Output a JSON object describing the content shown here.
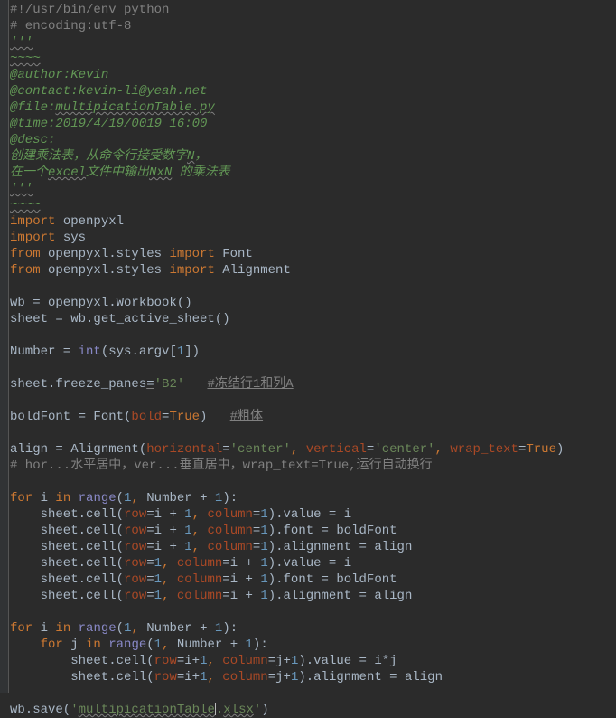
{
  "shebang": "#!/usr/bin/env python",
  "encoding": "# encoding:utf-8",
  "doc_open": "'''",
  "wave1": "~~~~",
  "author": "@author:Kevin",
  "contact": "@contact:kevin-li@yeah.net",
  "file_lbl": "@file:",
  "file_name": "multipicationTable.py",
  "time": "@time:2019/4/19/0019 16:00",
  "desc": "@desc:",
  "desc1_a": "创建乘法表，从命令行接受数字",
  "desc1_b": "N",
  "desc1_c": "，",
  "desc2_a": "在一个",
  "desc2_b": "excel",
  "desc2_c": "文件中输出",
  "desc2_d": "NxN",
  "desc2_e": " 的乘法表",
  "doc_close": "'''",
  "wave2": "~~~~",
  "imp1_kw": "import ",
  "imp1_mod": "openpyxl",
  "imp2_kw": "import ",
  "imp2_mod": "sys",
  "from1_kw": "from ",
  "from1_mod": "openpyxl.styles ",
  "from1_imp": "import ",
  "from1_what": "Font",
  "from2_kw": "from ",
  "from2_mod": "openpyxl.styles ",
  "from2_imp": "import ",
  "from2_what": "Alignment",
  "wb_line": "wb = openpyxl.Workbook()",
  "sheet_line": "sheet = wb.get_active_sheet()",
  "num_a": "Number = ",
  "num_b": "int",
  "num_c": "(sys.argv[",
  "num_d": "1",
  "num_e": "])",
  "freeze_a": "sheet.freeze_panes",
  "freeze_eq": "=",
  "freeze_b": "'B2'",
  "freeze_c": "#冻结行1和列A",
  "bold_a": "boldFont = Font(",
  "bold_p": "bold",
  "bold_eq": "=",
  "bold_v": "True",
  "bold_b": ")   ",
  "bold_c": "#粗体",
  "align_a": "align = Alignment(",
  "align_p1": "horizontal",
  "align_eq1": "=",
  "align_v1": "'center'",
  "align_comma1": ", ",
  "align_p2": "vertical",
  "align_eq2": "=",
  "align_v2": "'center'",
  "align_comma2": ", ",
  "align_p3": "wrap_text",
  "align_eq3": "=",
  "align_v3": "True",
  "align_b": ")",
  "align_comment": "# hor...水平居中，ver...垂直居中，wrap_text=True,运行自动换行",
  "for1_kw1": "for ",
  "for1_var": "i ",
  "for1_kw2": "in ",
  "for1_fn": "range",
  "for1_a": "(",
  "for1_n1": "1",
  "for1_c1": ", ",
  "for1_mid": "Number + ",
  "for1_n2": "1",
  "for1_b": "):",
  "l1_a": "    sheet.cell(",
  "l1_p1": "row",
  "l1_eq1": "=i + ",
  "l1_n1": "1",
  "l1_c1": ", ",
  "l1_p2": "column",
  "l1_eq2": "=",
  "l1_n2": "1",
  "l1_b": ").value = i",
  "l2_b": ").font = boldFont",
  "l3_b": ").alignment = align",
  "l4_a": "    sheet.cell(",
  "l4_p1": "row",
  "l4_eq1": "=",
  "l4_n1": "1",
  "l4_c1": ", ",
  "l4_p2": "column",
  "l4_eq2": "=i + ",
  "l4_n2": "1",
  "l4_b": ").value = i",
  "for2_kw1": "for ",
  "for2_var": "i ",
  "for2_kw2": "in ",
  "for2_fn": "range",
  "for2_a": "(",
  "for2_n1": "1",
  "for2_c1": ", ",
  "for2_mid": "Number + ",
  "for2_n2": "1",
  "for2_b": "):",
  "for3_ind": "    ",
  "for3_kw1": "for ",
  "for3_var": "j ",
  "for3_kw2": "in ",
  "for3_fn": "range",
  "for3_a": "(",
  "for3_n1": "1",
  "for3_c1": ", ",
  "for3_mid": "Number + ",
  "for3_n2": "1",
  "for3_b": "):",
  "in1_a": "        sheet.cell(",
  "in1_p1": "row",
  "in1_eq1": "=i+",
  "in1_n1": "1",
  "in1_c1": ", ",
  "in1_p2": "column",
  "in1_eq2": "=j+",
  "in1_n2": "1",
  "in1_b": ").value = i*j",
  "in2_b": ").alignment = align",
  "save_a": "wb.save(",
  "save_s1": "'",
  "save_s2": "multipicationTable",
  "save_s3": ".",
  "save_s4": "xlsx",
  "save_s5": "'",
  "save_b": ")",
  "chart_data": null
}
